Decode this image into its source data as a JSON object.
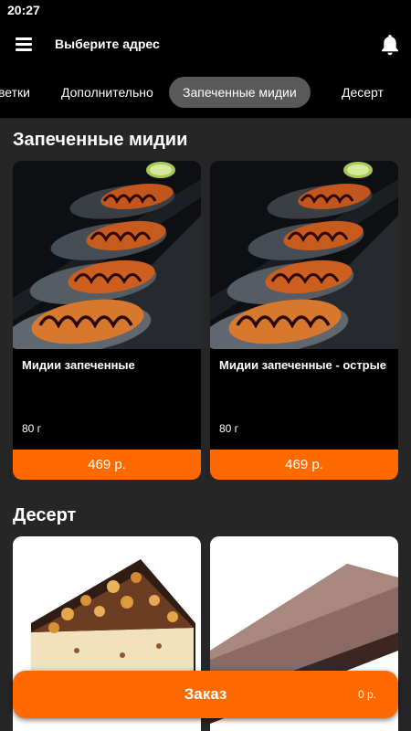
{
  "status_bar": {
    "time": "20:27"
  },
  "header": {
    "address_label": "Выберите адрес",
    "menu_icon": "hamburger-menu-icon",
    "bell_icon": "bell-icon"
  },
  "tabs": [
    {
      "label": "ветки",
      "active": false
    },
    {
      "label": "Дополнительно",
      "active": false
    },
    {
      "label": "Запеченные мидии",
      "active": true
    },
    {
      "label": "Десерт",
      "active": false
    }
  ],
  "sections": [
    {
      "title": "Запеченные мидии",
      "products": [
        {
          "name": "Мидии запеченные",
          "weight": "80 г",
          "price": "469 р."
        },
        {
          "name": "Мидии запеченные - острые",
          "weight": "80 г",
          "price": "469 р."
        }
      ]
    },
    {
      "title": "Десерт",
      "products": [
        {
          "name": "",
          "weight": "",
          "price": ""
        },
        {
          "name": "",
          "weight": "",
          "price": ""
        }
      ]
    }
  ],
  "order_button": {
    "label": "Заказ",
    "total": "0 р."
  },
  "colors": {
    "accent": "#ff6a00",
    "background": "#262626",
    "bar": "#000000",
    "active_tab": "#595959"
  }
}
